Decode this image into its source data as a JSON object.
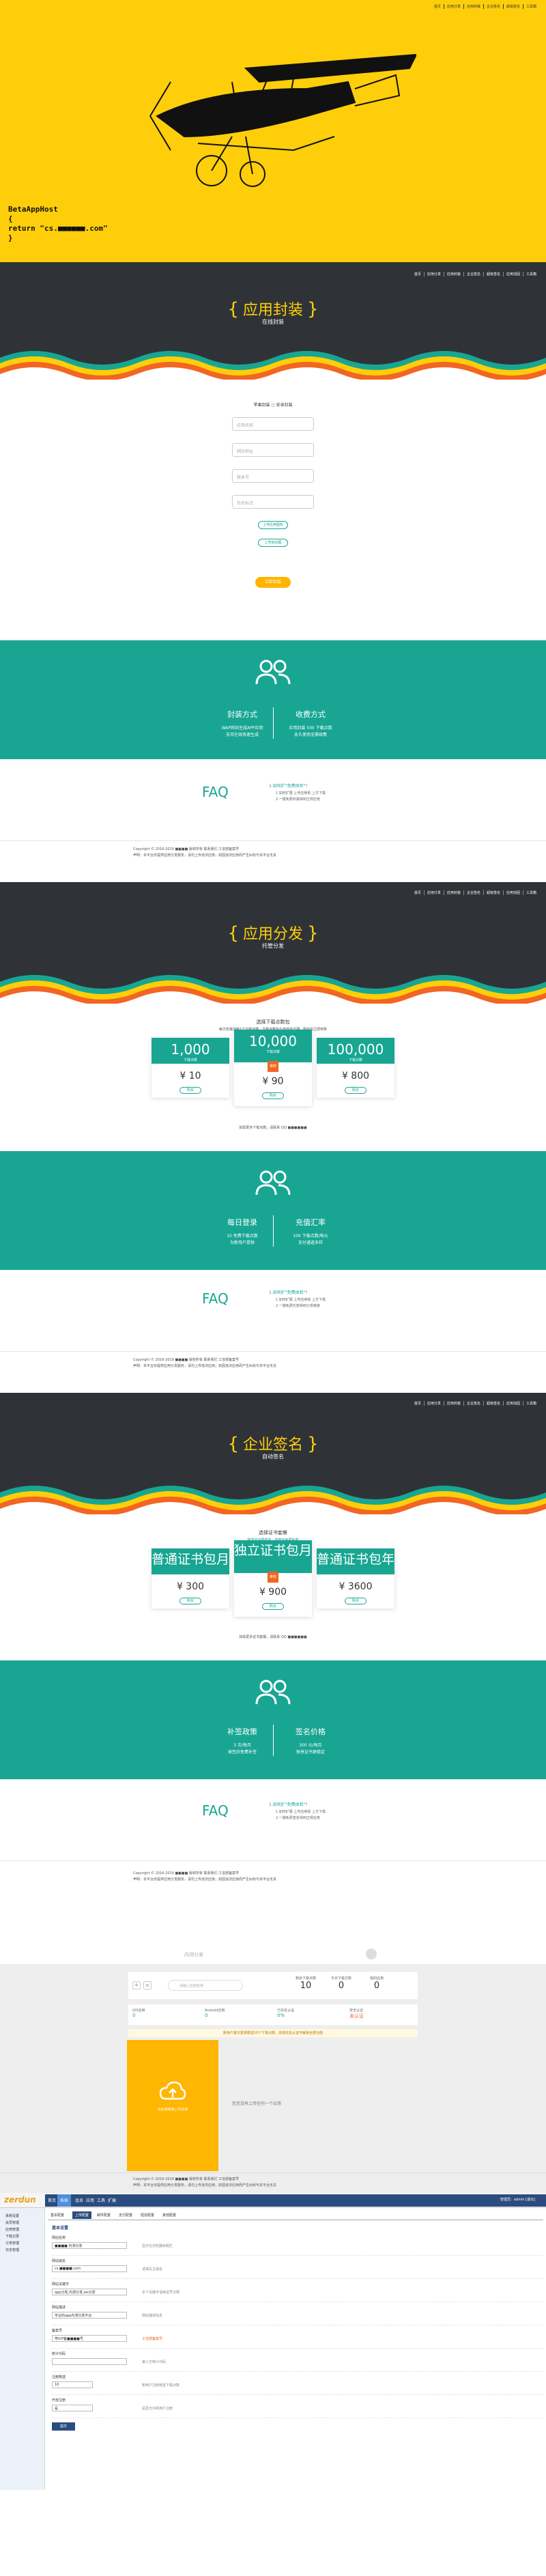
{
  "hero": {
    "nav": [
      "首页",
      "应用分发",
      "应用封装",
      "企业签名",
      "超级签名",
      "工具箱"
    ],
    "code_lines": [
      "BetaAppHost",
      "{",
      "    return \"cs.■■■■■■.com\"",
      "}"
    ]
  },
  "nav": [
    "首页",
    "应用分发",
    "应用封装",
    "企业签名",
    "超级签名",
    "应用加固",
    "工具箱"
  ],
  "wrap": {
    "title": "应用封装",
    "subtitle": "在线封装",
    "radio": "苹果封装  ○ 安卓封装",
    "fields": [
      "应用名称",
      "网站地址",
      "版本号",
      "包名标识"
    ],
    "upload_icon": "上传应用图标",
    "upload_launch": "上传启动图",
    "submit": "立即封装",
    "feature1_title": "封装方式",
    "feature1_text": [
      "WAP网站生成APP应用",
      "支持在线快速生成"
    ],
    "feature2_title": "收费方式",
    "feature2_text": [
      "应用封装 500 下载点数",
      "永久使用无需续费"
    ],
    "faq": "FAQ",
    "faq_q": "1.如何扩\"免费体验\"?",
    "faq_a": [
      "1.如何扩展 上传应用看 上方下载",
      "2.一键免费封装得到正规应用"
    ]
  },
  "footer": {
    "lines": [
      "Copyright © 2016-2019 ■■■■ 版权所有 联系我们 工信部备案号",
      "声明：本平台仅提供应用分发服务，请勿上传违法应用，如因违法应用而产生纠纷与本平台无关"
    ]
  },
  "dist": {
    "title": "应用分发",
    "subtitle": "托管分发",
    "heading": "选择下载点数包",
    "desc": "每次安装消耗1个下载点数，下载点数永久有效不过期，购买后立即到账",
    "cards": [
      {
        "count": "1,000",
        "unit": "下载点数",
        "price": "¥ 10",
        "buy": "购买"
      },
      {
        "count": "10,000",
        "unit": "下载点数",
        "badge": "推荐",
        "price": "¥ 90",
        "buy": "购买"
      },
      {
        "count": "100,000",
        "unit": "下载点数",
        "price": "¥ 800",
        "buy": "购买"
      }
    ],
    "note": "如需更多下载点数，请联系 QQ ■■■■■■",
    "feature1_title": "每日登录",
    "feature1_text": [
      "10 免费下载点数",
      "为新用户提供"
    ],
    "feature2_title": "充值汇率",
    "feature2_text": [
      "100 下载点数/每元",
      "支付通道多样"
    ],
    "faq": "FAQ",
    "faq_q": "1.如何扩\"免费体验\"?",
    "faq_a": [
      "1.如何扩展 上传应用看 上方下载",
      "2.一键免费托管得到分发链接"
    ]
  },
  "sign": {
    "title": "企业签名",
    "subtitle": "自动签名",
    "heading": "选择证书套餐",
    "desc": "独享证书更稳定，掉签后免费补签",
    "cards": [
      {
        "name": "普通证书包月",
        "price": "¥ 300",
        "buy": "购买"
      },
      {
        "name": "独立证书包月",
        "badge": "推荐",
        "price": "¥ 900",
        "buy": "购买"
      },
      {
        "name": "普通证书包年",
        "price": "¥ 3600",
        "buy": "购买"
      }
    ],
    "note": "如需更多证书套餐，请联系 QQ ■■■■■■",
    "feature1_title": "补签政策",
    "feature1_text": [
      "3 次/每月",
      "掉签后免费补签"
    ],
    "feature2_title": "签名价格",
    "feature2_text": [
      "300 元/每月",
      "独享证书更稳定"
    ],
    "faq": "FAQ",
    "faq_q": "1.如何扩\"免费体验\"?",
    "faq_a": [
      "1.如何扩展 上传应用看 上方下载",
      "2.一键免费签名得到正规应用"
    ]
  },
  "dashboard": {
    "logo": "内测分发",
    "search": "请输入应用名称",
    "stats": [
      {
        "label": "剩余下载点数",
        "value": "10"
      },
      {
        "label": "今日下载次数",
        "value": "0"
      },
      {
        "label": "我的应用",
        "value": "0"
      }
    ],
    "cards": [
      {
        "label": "iOS应用",
        "value": "0"
      },
      {
        "label": "Android应用",
        "value": "0"
      },
      {
        "label": "已实名认证",
        "value": "0%"
      },
      {
        "label": "安全认证",
        "value": "未认证"
      }
    ],
    "notice": "新用户首次登录赠送10个下载点数，完成实名认证可解锁全部功能",
    "upload_hint": "点击或拖拽上传应用",
    "empty": "您还没有上传任何一个应用"
  },
  "admin": {
    "brand": "zerdun",
    "top_tabs": [
      "首页",
      "系统",
      "会员",
      "应用",
      "工具",
      "扩展"
    ],
    "user": "管理员：admin [退出]",
    "sub_tabs": [
      "基本配置",
      "上传配置",
      "邮件配置",
      "支付配置",
      "短信配置",
      "其他配置"
    ],
    "side": [
      "系统设置",
      "会员管理",
      "应用管理",
      "下载记录",
      "订单管理",
      "日志管理"
    ],
    "section": "基本设置",
    "rows": [
      {
        "label": "网站名称",
        "value": "■■■■ 内测分发",
        "hint": "显示在浏览器标题栏"
      },
      {
        "label": "网站域名",
        "value": "cs.■■■■.com",
        "hint": "请填写主域名"
      },
      {
        "label": "网站关键字",
        "value": "app分发,内测分发,ios分发",
        "hint": "多个关键字请用逗号分隔"
      },
      {
        "label": "网站描述",
        "value": "专业的app内测分发平台",
        "hint": "网站描述信息"
      },
      {
        "label": "备案号",
        "value": "粤ICP备■■■■号",
        "hint": "工信部备案号"
      },
      {
        "label": "统计代码",
        "value": "",
        "hint": "第三方统计代码"
      },
      {
        "label": "注册赠送",
        "value": "10",
        "hint": "新用户注册赠送下载点数"
      },
      {
        "label": "开放注册",
        "value": "是",
        "hint": "是否允许新用户注册"
      }
    ],
    "save": "提交"
  }
}
